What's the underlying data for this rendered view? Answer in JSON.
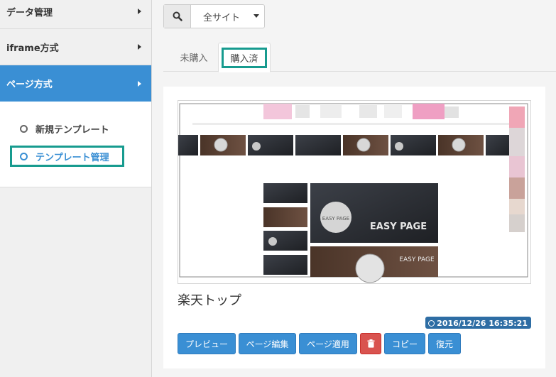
{
  "sidebar": {
    "items": [
      {
        "label": "データ管理"
      },
      {
        "label": "iframe方式"
      },
      {
        "label": "ページ方式"
      }
    ],
    "submenu": [
      {
        "label": "新規テンプレート"
      },
      {
        "label": "テンプレート管理"
      }
    ]
  },
  "toolbar": {
    "site_select": "全サイト"
  },
  "tabs": [
    {
      "label": "未購入"
    },
    {
      "label": "購入済"
    }
  ],
  "template": {
    "title": "楽天トップ",
    "timestamp": "2016/12/26 16:35:21",
    "preview_text": "EASY PAGE"
  },
  "actions": {
    "preview": "プレビュー",
    "edit": "ページ編集",
    "apply": "ページ適用",
    "copy": "コピー",
    "restore": "復元"
  },
  "colors": {
    "accent": "#3a8fd4",
    "highlight": "#179b8f",
    "danger": "#d9534f",
    "badge": "#2e6da4"
  }
}
